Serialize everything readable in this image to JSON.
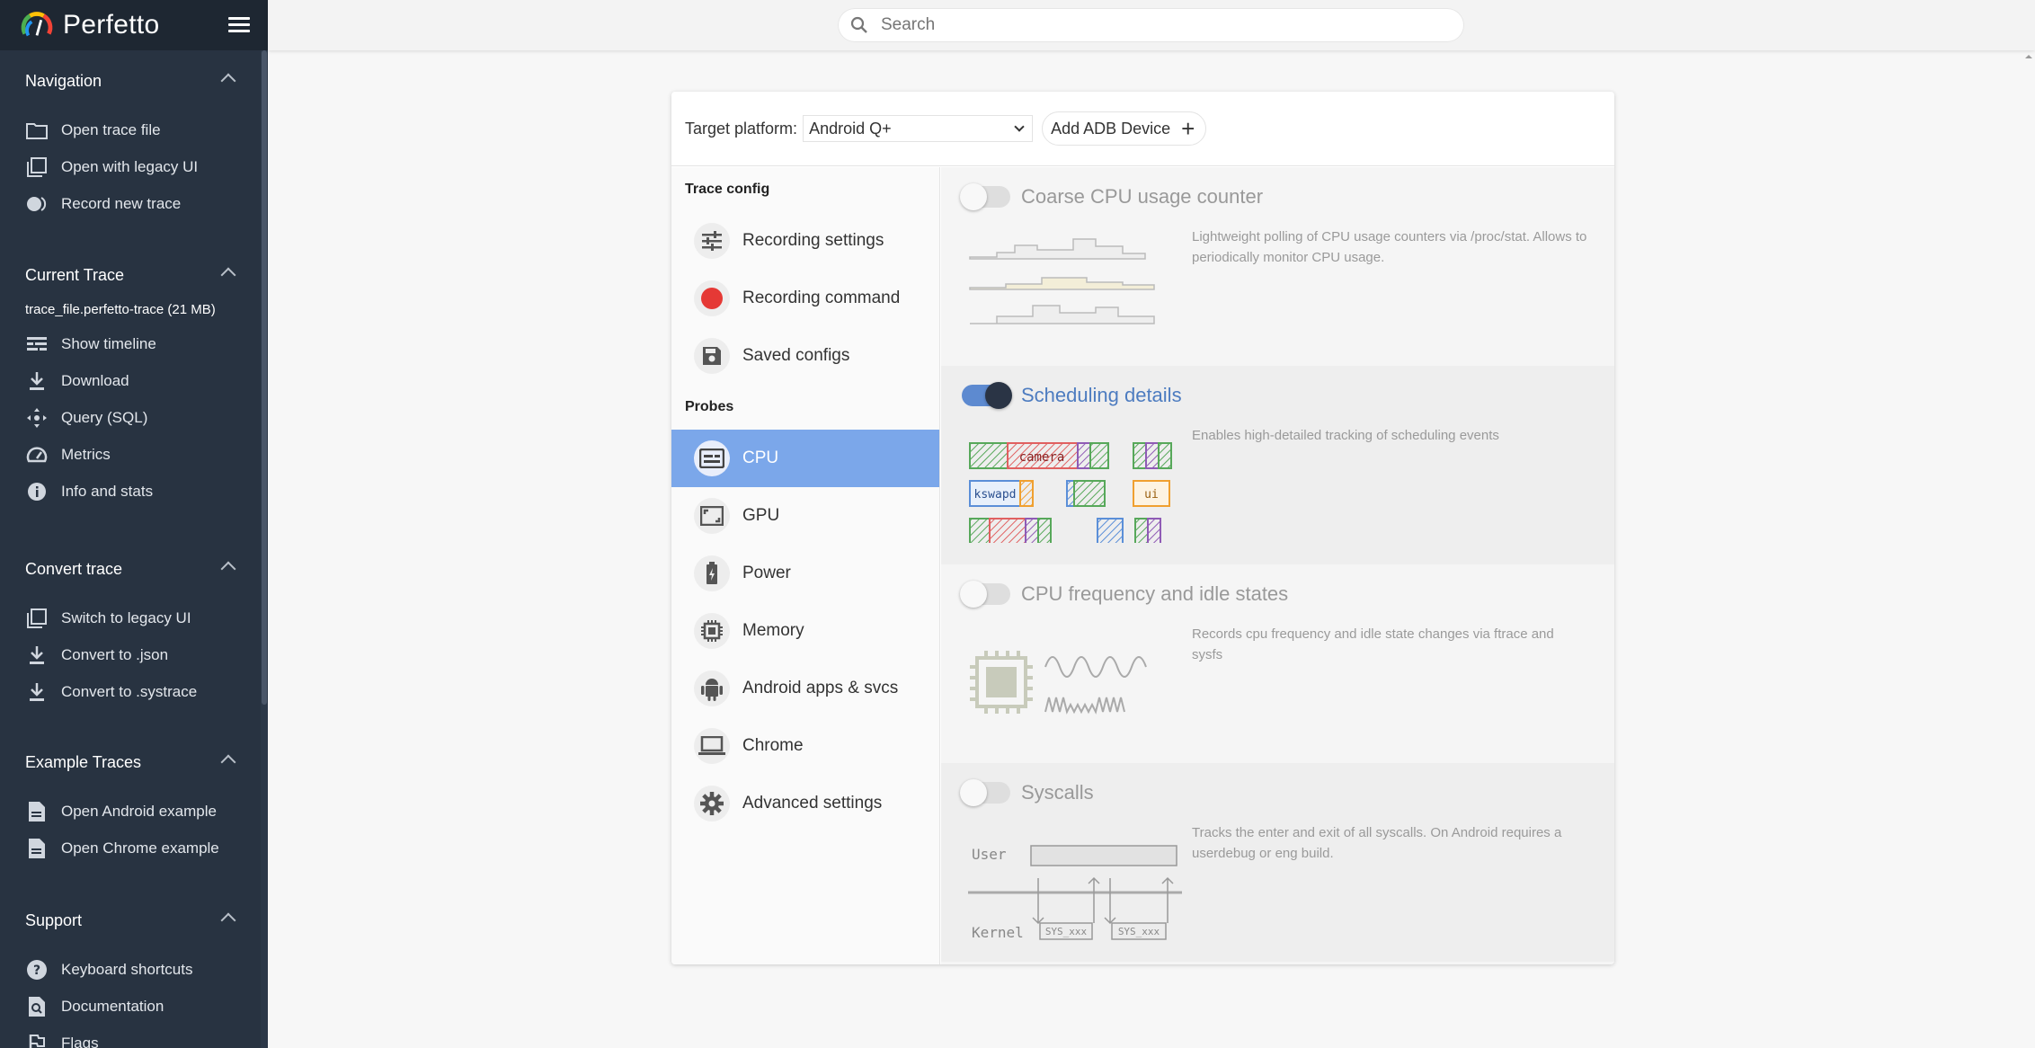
{
  "app": {
    "name": "Perfetto"
  },
  "search": {
    "placeholder": "Search"
  },
  "sidebar": {
    "sections": [
      {
        "title": "Navigation",
        "items": [
          {
            "label": "Open trace file",
            "icon": "folder-icon"
          },
          {
            "label": "Open with legacy UI",
            "icon": "filter-none-icon"
          },
          {
            "label": "Record new trace",
            "icon": "fiber-smart-record-icon"
          }
        ]
      },
      {
        "title": "Current Trace",
        "trace_file": "trace_file.perfetto-trace (21 MB)",
        "items": [
          {
            "label": "Show timeline",
            "icon": "timeline-view-icon"
          },
          {
            "label": "Download",
            "icon": "download-icon"
          },
          {
            "label": "Query (SQL)",
            "icon": "control-camera-icon"
          },
          {
            "label": "Metrics",
            "icon": "speed-icon"
          },
          {
            "label": "Info and stats",
            "icon": "info-icon"
          }
        ]
      },
      {
        "title": "Convert trace",
        "items": [
          {
            "label": "Switch to legacy UI",
            "icon": "filter-none-icon"
          },
          {
            "label": "Convert to .json",
            "icon": "download-icon"
          },
          {
            "label": "Convert to .systrace",
            "icon": "download-icon"
          }
        ]
      },
      {
        "title": "Example Traces",
        "items": [
          {
            "label": "Open Android example",
            "icon": "description-icon"
          },
          {
            "label": "Open Chrome example",
            "icon": "description-icon"
          }
        ]
      },
      {
        "title": "Support",
        "items": [
          {
            "label": "Keyboard shortcuts",
            "icon": "help-icon"
          },
          {
            "label": "Documentation",
            "icon": "find-in-page-icon"
          },
          {
            "label": "Flags",
            "icon": "emoji-flags-icon"
          }
        ]
      }
    ]
  },
  "record": {
    "target_label": "Target platform:",
    "target_value": "Android Q+",
    "add_device_label": "Add ADB Device",
    "trace_config_heading": "Trace config",
    "config_items": [
      {
        "label": "Recording settings",
        "icon": "tune-icon"
      },
      {
        "label": "Recording command",
        "icon": "record-dot-icon"
      },
      {
        "label": "Saved configs",
        "icon": "save-icon"
      }
    ],
    "probes_heading": "Probes",
    "probe_items": [
      {
        "label": "CPU",
        "icon": "cpu-icon",
        "active": true
      },
      {
        "label": "GPU",
        "icon": "gpu-icon"
      },
      {
        "label": "Power",
        "icon": "battery-icon"
      },
      {
        "label": "Memory",
        "icon": "memory-icon"
      },
      {
        "label": "Android apps & svcs",
        "icon": "android-icon"
      },
      {
        "label": "Chrome",
        "icon": "laptop-icon"
      },
      {
        "label": "Advanced settings",
        "icon": "settings-icon"
      }
    ],
    "probes": [
      {
        "title": "Coarse CPU usage counter",
        "enabled": false,
        "description": "Lightweight polling of CPU usage counters via /proc/stat. Allows to periodically monitor CPU usage."
      },
      {
        "title": "Scheduling details",
        "enabled": true,
        "description": "Enables high-detailed tracking of scheduling events",
        "image_labels": [
          "camera",
          "kswapd",
          "ui"
        ]
      },
      {
        "title": "CPU frequency and idle states",
        "enabled": false,
        "description": "Records cpu frequency and idle state changes via ftrace and sysfs"
      },
      {
        "title": "Syscalls",
        "enabled": false,
        "description": "Tracks the enter and exit of all syscalls. On Android requires a userdebug or eng build.",
        "image_labels": [
          "User",
          "Kernel",
          "SYS_xxx",
          "SYS_xxx"
        ]
      }
    ]
  },
  "colors": {
    "sidebar_bg": "#283341",
    "accent": "#7ba7ea",
    "toggle_on": "#5d8ad0",
    "record_red": "#e53935"
  }
}
